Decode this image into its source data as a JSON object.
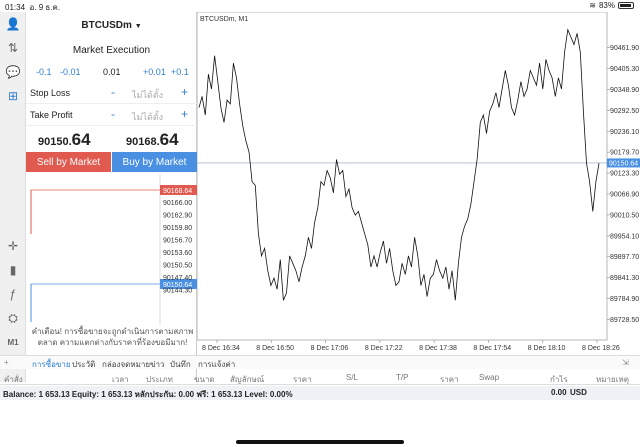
{
  "status": {
    "time": "01:34",
    "date": "อ. 9 ธ.ค.",
    "battery": "83%"
  },
  "toolbar": {
    "m1": "M1"
  },
  "order": {
    "symbol": "BTCUSDm",
    "execution": "Market Execution",
    "vol": [
      "-0.1",
      "-0.01",
      "0.01",
      "+0.01",
      "+0.1"
    ],
    "stop_loss": "Stop Loss",
    "take_profit": "Take Profit",
    "not_set": "ไม่ได้ตั้ง",
    "minus": "-",
    "plus": "+",
    "bid_main": "90150.",
    "bid_big": "64",
    "ask_main": "90168.",
    "ask_big": "64",
    "sell_label": "Sell by Market",
    "buy_label": "Buy by Market",
    "ask_tag": "90168.64",
    "bid_tag": "90150.64",
    "tick_prices": [
      "90166.00",
      "90162.90",
      "90159.80",
      "90156.70",
      "90153.60",
      "90150.50",
      "90147.40",
      "90144.30"
    ],
    "warning": "คำเตือน! การซื้อขายจะถูกดำเนินการตามสภาพตลาด ความแตกต่างกับราคาที่ร้องขอมีมาก!"
  },
  "chart_title": "BTCUSDm, M1",
  "chart_data": {
    "type": "line",
    "title": "BTCUSDm, M1",
    "ylim": [
      89700,
      90520
    ],
    "y_ticks": [
      "90461.90",
      "90405.30",
      "90348.90",
      "90292.50",
      "90236.10",
      "90179.70",
      "90123.30",
      "90066.90",
      "90010.50",
      "89954.10",
      "89897.70",
      "89841.30",
      "89784.90",
      "89728.50"
    ],
    "x_ticks": [
      "8 Dec 16:34",
      "8 Dec 16:50",
      "8 Dec 17:06",
      "8 Dec 17:22",
      "8 Dec 17:38",
      "8 Dec 17:54",
      "8 Dec 18:10",
      "8 Dec 18:26"
    ],
    "current_price": "90150.64",
    "values": [
      90300,
      90330,
      90280,
      90390,
      90350,
      90440,
      90370,
      90300,
      90260,
      90320,
      90310,
      90420,
      90380,
      90310,
      90250,
      90210,
      90180,
      90100,
      90090,
      89960,
      89900,
      89920,
      89860,
      89820,
      89840,
      89810,
      89890,
      89780,
      89800,
      89900,
      89880,
      89860,
      89830,
      89870,
      89900,
      89950,
      89920,
      89990,
      90030,
      90100,
      90090,
      90130,
      90110,
      90070,
      90160,
      90120,
      90130,
      90060,
      90080,
      90030,
      90010,
      90020,
      89990,
      89960,
      89930,
      89870,
      89900,
      89870,
      89910,
      89940,
      89880,
      89920,
      89860,
      89820,
      89830,
      89880,
      89850,
      89900,
      89870,
      89950,
      89900,
      89820,
      89850,
      89790,
      89840,
      89850,
      89890,
      89860,
      89840,
      89870,
      89810,
      89860,
      89780,
      89880,
      89950,
      89980,
      90000,
      90040,
      90100,
      90160,
      90260,
      90280,
      90230,
      90290,
      90310,
      90340,
      90300,
      90350,
      90400,
      90360,
      90300,
      90280,
      90320,
      90370,
      90330,
      90350,
      90400,
      90380,
      90360,
      90420,
      90350,
      90430,
      90400,
      90380,
      90330,
      90380,
      90350,
      90450,
      90510,
      90490,
      90470,
      90500,
      90450,
      90290,
      90150,
      90100,
      90020,
      90100,
      90150
    ]
  },
  "tabs": [
    "การซื้อขาย",
    "ประวัติ",
    "กล่องจดหมาย",
    "ข่าว",
    "บันทึก",
    "การแจ้งค่า"
  ],
  "columns": [
    "คำสั่ง",
    "เวลา",
    "ประเภท",
    "ขนาด",
    "สัญลักษณ์",
    "ราคา",
    "S/L",
    "T/P",
    "ราคา",
    "Swap",
    "กำไร",
    "หมายเหตุ"
  ],
  "balance": {
    "text": "Balance: 1 653.13 Equity: 1 653.13 หลักประกัน: 0.00 ฟรี: 1 653.13 Level: 0.00%",
    "amount": "0.00",
    "currency": "USD"
  },
  "colors": {
    "sell": "#e05a4f",
    "buy": "#4a90e2",
    "accent": "#2f7fd5"
  }
}
